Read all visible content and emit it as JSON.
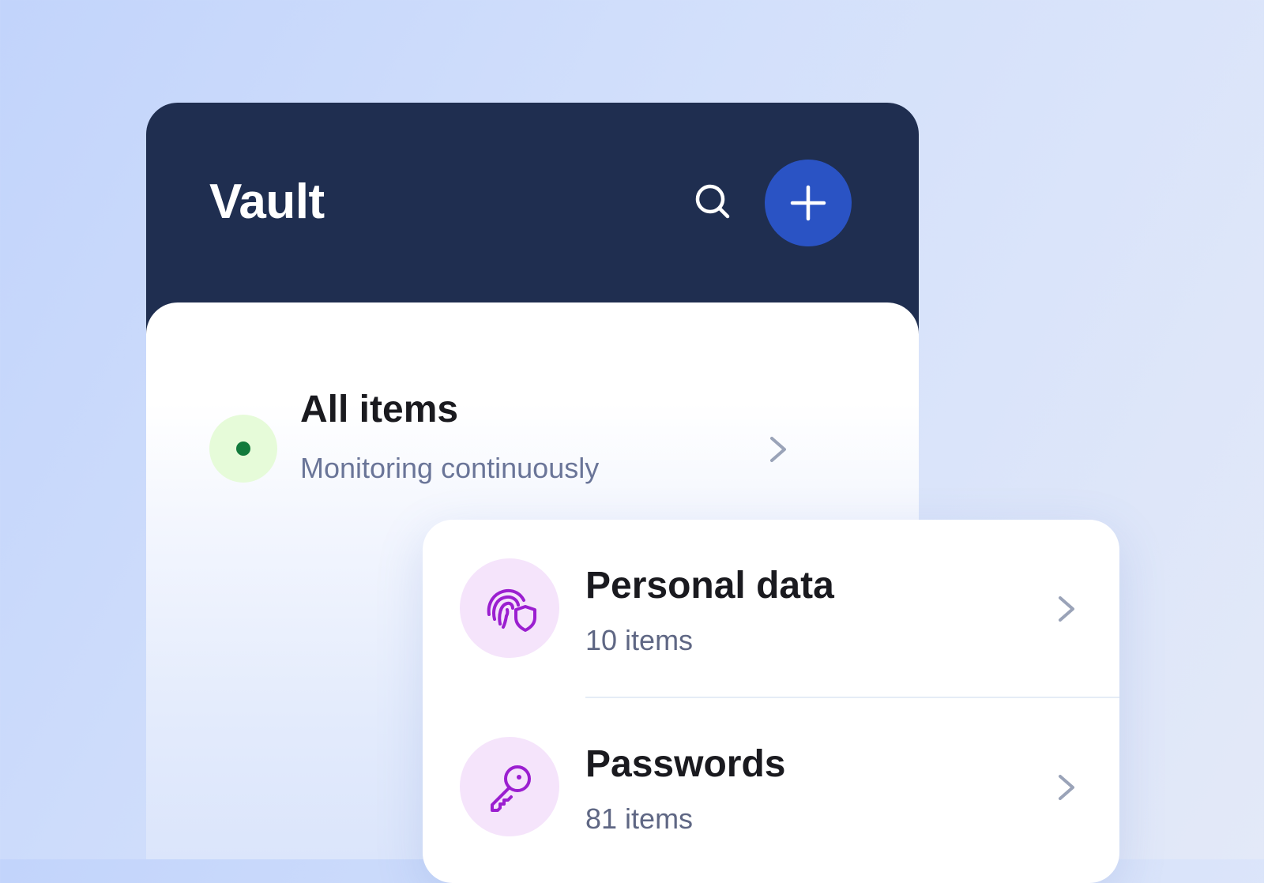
{
  "header": {
    "title": "Vault",
    "search_icon": "search-icon",
    "add_icon": "plus-icon",
    "add_button_color": "#2a53c4",
    "background_color": "#1f2e50"
  },
  "all_items": {
    "title": "All items",
    "subtitle": "Monitoring continuously",
    "status": "active",
    "status_color": "#127a3c"
  },
  "categories": [
    {
      "title": "Personal data",
      "count": "10 items",
      "icon": "fingerprint-shield-icon"
    },
    {
      "title": "Passwords",
      "count": "81 items",
      "icon": "key-icon"
    }
  ],
  "colors": {
    "accent_purple": "#9b1fd0",
    "icon_bg": "#f5e4fb",
    "status_bg": "#e6fbd9"
  }
}
